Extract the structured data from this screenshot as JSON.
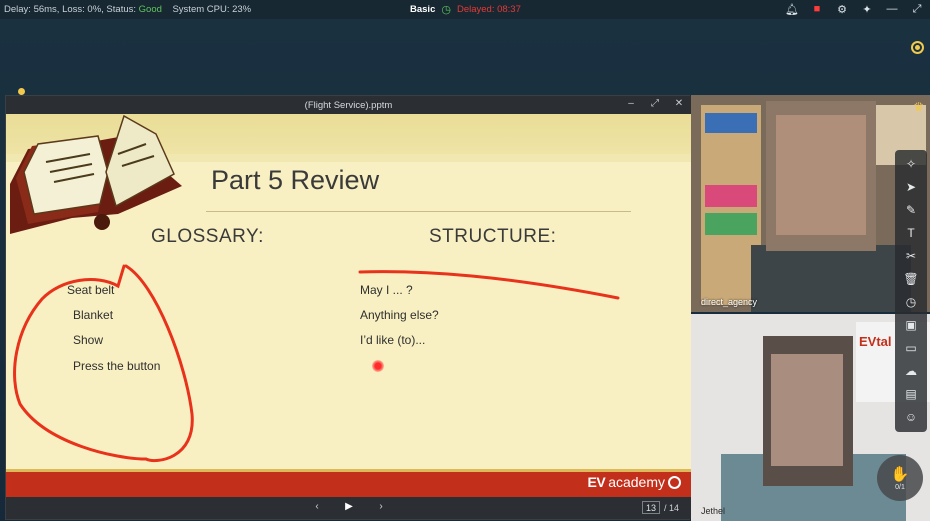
{
  "status": {
    "delay": "Delay: 56ms, Loss: 0%, Status: ",
    "status_value": "Good",
    "cpu": "System CPU: 23%",
    "mode": "Basic",
    "delayed": "Delayed: 08:37"
  },
  "toolbar_icons": [
    "bell-icon",
    "record-icon",
    "settings-icon",
    "pin-icon",
    "minimize-icon",
    "maximize-icon"
  ],
  "ppt": {
    "filename": "(Flight Service).pptm",
    "slide": {
      "title": "Part 5 Review",
      "glossary_heading": "GLOSSARY:",
      "structure_heading": "STRUCTURE:",
      "glossary_items": [
        "Seat belt",
        "Blanket",
        "Show",
        "Press the button"
      ],
      "structure_items": [
        "May I ... ?",
        "Anything else?",
        "I’d like (to)..."
      ],
      "logo_ev": "EV",
      "logo_academy": "academy"
    },
    "current_page": "13",
    "total_pages": "/ 14"
  },
  "videos": [
    {
      "label": "direct_agency"
    },
    {
      "label": "Jethel"
    }
  ],
  "hand_raise": {
    "count": "0/1"
  },
  "colors": {
    "status_good": "#5ec45e",
    "delayed": "#e53935",
    "accent": "#f2c94c",
    "slide_bg": "#f8f0c2",
    "footer": "#c2301c",
    "annotation": "#e8321c"
  }
}
